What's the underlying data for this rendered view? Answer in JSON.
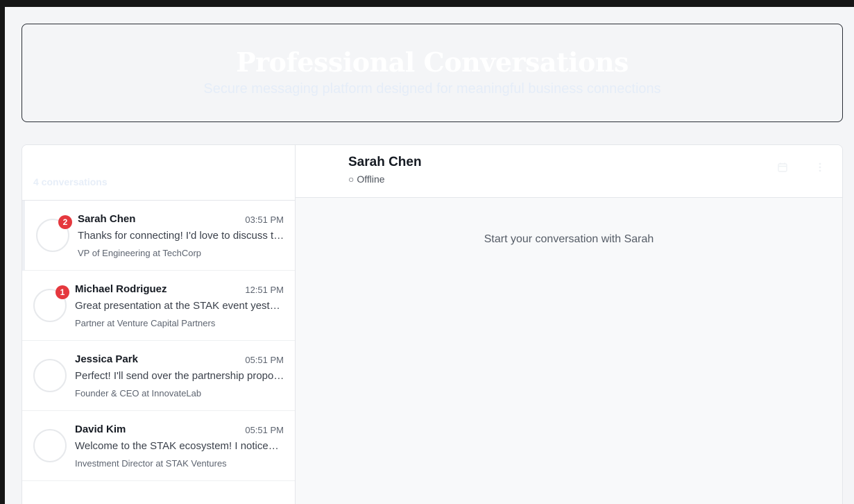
{
  "hero": {
    "title": "Professional Conversations",
    "subtitle": "Secure messaging platform designed for meaningful business connections"
  },
  "sidebar": {
    "count_text": "4 conversations",
    "conversations": [
      {
        "name": "Sarah Chen",
        "time": "03:51 PM",
        "preview": "Thanks for connecting! I'd love to discuss the partnership opportunity",
        "role": "VP of Engineering at TechCorp",
        "unread": "2"
      },
      {
        "name": "Michael Rodriguez",
        "time": "12:51 PM",
        "preview": "Great presentation at the STAK event yesterday!",
        "role": "Partner at Venture Capital Partners",
        "unread": "1"
      },
      {
        "name": "Jessica Park",
        "time": "05:51 PM",
        "preview": "Perfect! I'll send over the partnership proposal",
        "role": "Founder & CEO at InnovateLab",
        "unread": ""
      },
      {
        "name": "David Kim",
        "time": "05:51 PM",
        "preview": "Welcome to the STAK ecosystem! I noticed your work",
        "role": "Investment Director at STAK Ventures",
        "unread": ""
      }
    ]
  },
  "chat": {
    "contact_name": "Sarah Chen",
    "status": "○ Offline",
    "empty_message": "Start your conversation with Sarah"
  },
  "icons": {
    "calendar": "calendar-icon",
    "more": "more-vertical-icon"
  },
  "colors": {
    "badge": "#e5383e",
    "frame": "#161616",
    "background": "#f4f5f7"
  }
}
